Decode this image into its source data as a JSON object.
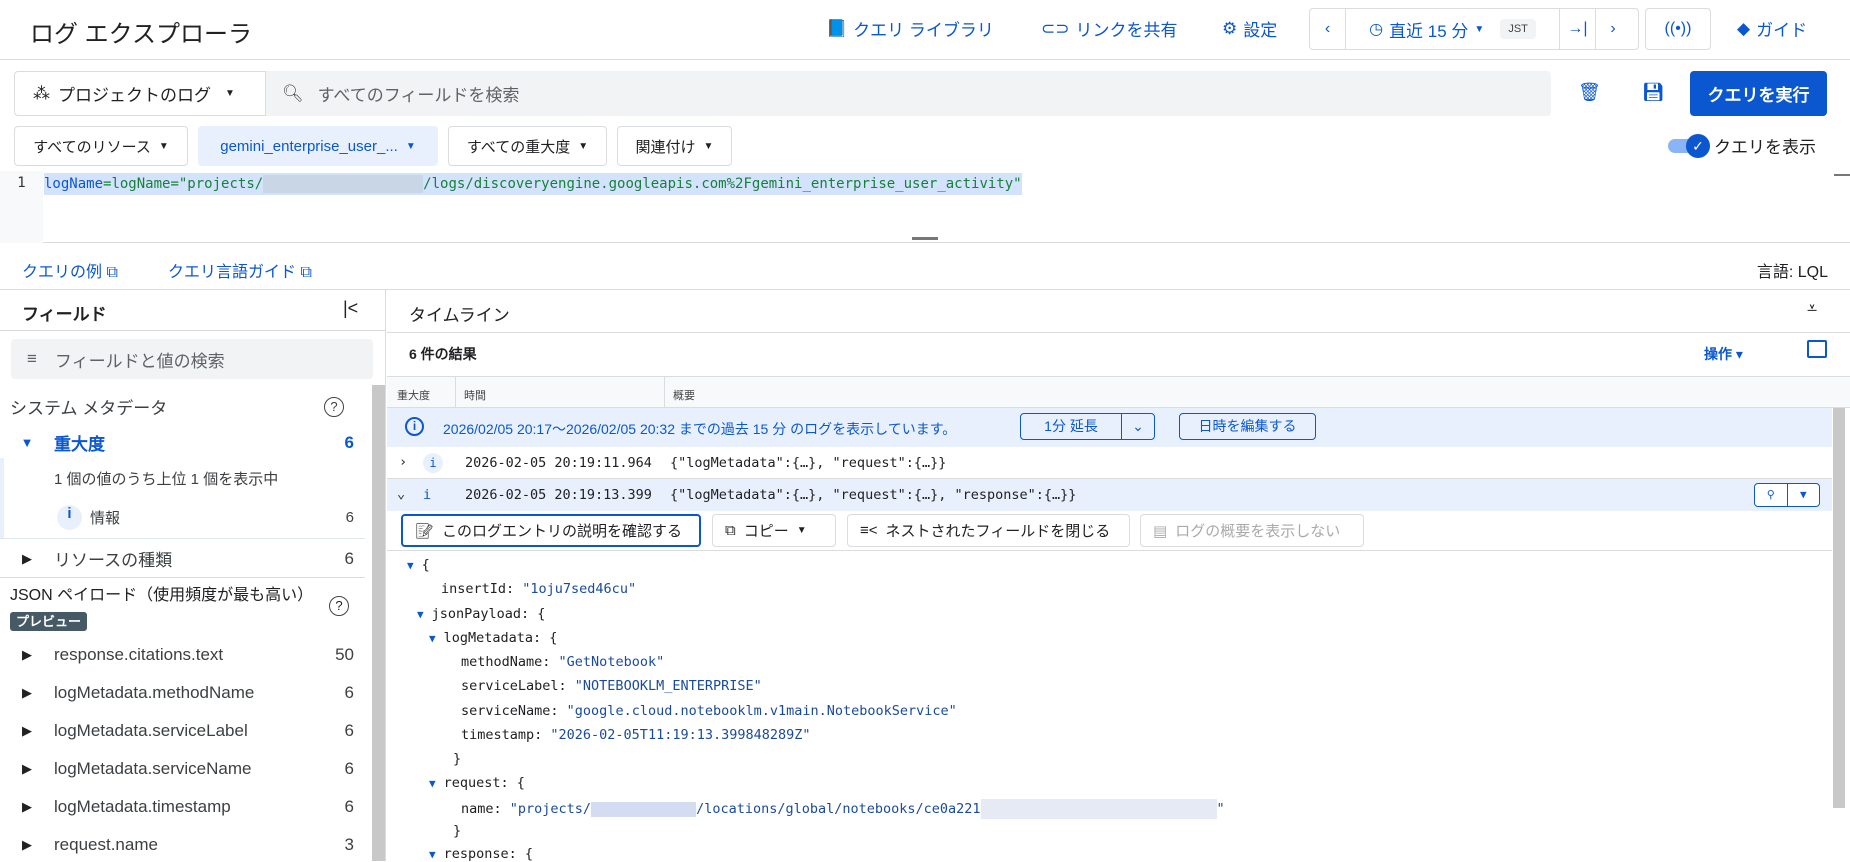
{
  "header": {
    "title": "ログ エクスプローラ",
    "query_library": "クエリ ライブラリ",
    "share_link": "リンクを共有",
    "settings": "設定",
    "time_range": "直近 15 分",
    "timezone": "JST",
    "guide": "ガイド"
  },
  "toolbar": {
    "project_scope": "プロジェクトのログ",
    "search_placeholder": "すべてのフィールドを検索",
    "run_query": "クエリを実行",
    "show_query": "クエリを表示"
  },
  "filters": {
    "resources": "すべてのリソース",
    "log_name": "gemini_enterprise_user_...",
    "severity": "すべての重大度",
    "correlate": "関連付け"
  },
  "editor": {
    "line_number": "1",
    "query_prefix": "logName=\"projects/",
    "query_suffix": "/logs/discoveryengine.googleapis.com%2Fgemini_enterprise_user_activity\""
  },
  "links": {
    "examples": "クエリの例",
    "language_guide": "クエリ言語ガイド",
    "language": "言語: LQL"
  },
  "fields": {
    "title": "フィールド",
    "search_placeholder": "フィールドと値の検索",
    "system_metadata": "システム メタデータ",
    "severity": {
      "label": "重大度",
      "count": "6",
      "summary": "1 個の値のうち上位 1 個を表示中",
      "value": "情報",
      "value_count": "6"
    },
    "resource_type": {
      "label": "リソースの種類",
      "count": "6"
    },
    "json_payload_title": "JSON ペイロード（使用頻度が最も高い）",
    "preview_badge": "プレビュー",
    "items": [
      {
        "label": "response.citations.text",
        "count": "50"
      },
      {
        "label": "logMetadata.methodName",
        "count": "6"
      },
      {
        "label": "logMetadata.serviceLabel",
        "count": "6"
      },
      {
        "label": "logMetadata.serviceName",
        "count": "6"
      },
      {
        "label": "logMetadata.timestamp",
        "count": "6"
      },
      {
        "label": "request.name",
        "count": "3"
      }
    ]
  },
  "results": {
    "timeline": "タイムライン",
    "count": "6 件の結果",
    "actions": "操作",
    "columns": [
      "重大度",
      "時間",
      "概要"
    ],
    "banner": "2026/02/05 20:17〜2026/02/05 20:32 までの過去 15 分 のログを表示しています。",
    "extend": "1分 延長",
    "edit_time": "日時を編集する",
    "rows": [
      {
        "time": "2026-02-05 20:19:11.964",
        "summary": "{\"logMetadata\":{…}, \"request\":{…}}"
      },
      {
        "time": "2026-02-05 20:19:13.399",
        "summary": "{\"logMetadata\":{…}, \"request\":{…}, \"response\":{…}}"
      }
    ],
    "explain": "このログエントリの説明を確認する",
    "copy": "コピー",
    "collapse": "ネストされたフィールドを閉じる",
    "hide_summary": "ログの概要を表示しない",
    "json": {
      "open": "{",
      "insertId_k": "insertId: ",
      "insertId_v": "\"1oju7sed46cu\"",
      "jsonPayload": "jsonPayload: {",
      "logMetadata": "logMetadata: {",
      "methodName_k": "methodName: ",
      "methodName_v": "\"GetNotebook\"",
      "serviceLabel_k": "serviceLabel: ",
      "serviceLabel_v": "\"NOTEBOOKLM_ENTERPRISE\"",
      "serviceName_k": "serviceName: ",
      "serviceName_v": "\"google.cloud.notebooklm.v1main.NotebookService\"",
      "timestamp_k": "timestamp: ",
      "timestamp_v": "\"2026-02-05T11:19:13.399848289Z\"",
      "close": "}",
      "request": "request: {",
      "name_k": "name: ",
      "name_v1": "\"projects/",
      "name_v2": "/locations/global/notebooks/ce0a221",
      "name_v3": "\"",
      "response": "response: {"
    }
  }
}
